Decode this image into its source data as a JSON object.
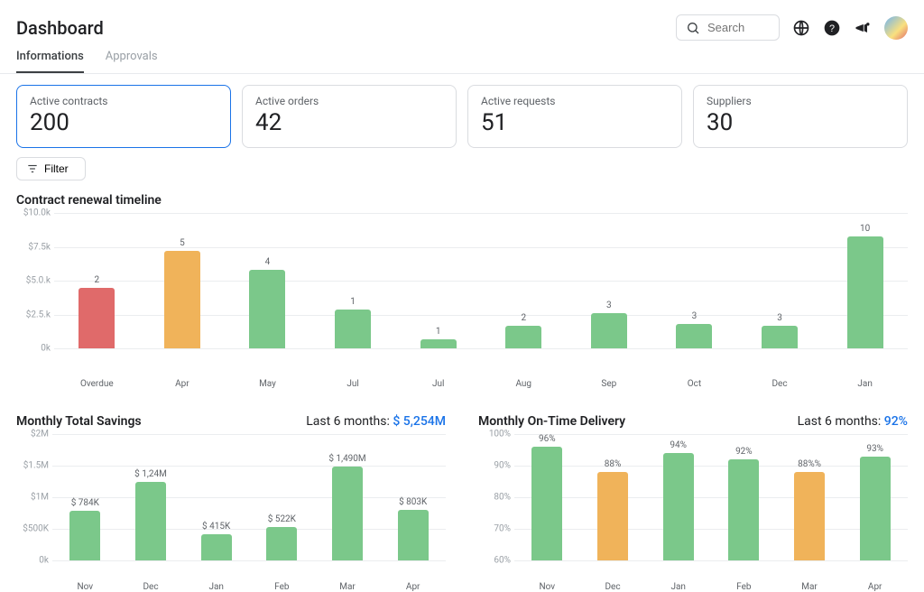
{
  "header": {
    "title": "Dashboard",
    "search_placeholder": "Search"
  },
  "tabs": {
    "informations": "Informations",
    "approvals": "Approvals"
  },
  "kpis": [
    {
      "label": "Active contracts",
      "value": "200",
      "active": true
    },
    {
      "label": "Active orders",
      "value": "42",
      "active": false
    },
    {
      "label": "Active requests",
      "value": "51",
      "active": false
    },
    {
      "label": "Suppliers",
      "value": "30",
      "active": false
    }
  ],
  "filter_label": "Filter",
  "renewal_title": "Contract renewal timeline",
  "chart_data": [
    {
      "type": "bar",
      "title": "Contract renewal timeline",
      "xlabel": "",
      "ylabel": "",
      "ylim": [
        0,
        10000
      ],
      "y_ticks": [
        "0k",
        "$2.5.k",
        "$5.0.k",
        "$7.5k",
        "$10.0k"
      ],
      "categories": [
        "Overdue",
        "Apr",
        "May",
        "Jul",
        "Jul",
        "Aug",
        "Sep",
        "Oct",
        "Dec",
        "Jan"
      ],
      "bar_value_labels": [
        "2",
        "5",
        "4",
        "1",
        "1",
        "2",
        "3",
        "3",
        "3",
        "10"
      ],
      "values": [
        4500,
        7200,
        5800,
        2900,
        700,
        1700,
        2600,
        1800,
        1700,
        8300
      ],
      "colors": [
        "#e06a6a",
        "#f0b35a",
        "#7bc88a",
        "#7bc88a",
        "#7bc88a",
        "#7bc88a",
        "#7bc88a",
        "#7bc88a",
        "#7bc88a",
        "#7bc88a"
      ]
    },
    {
      "type": "bar",
      "title": "Monthly Total Savings",
      "subtitle_label": "Last 6 months:",
      "subtitle_value": "$ 5,254M",
      "xlabel": "",
      "ylabel": "",
      "ylim": [
        0,
        2000000
      ],
      "y_ticks": [
        "0k",
        "$500K",
        "$1M",
        "$1.5M",
        "$2M"
      ],
      "categories": [
        "Nov",
        "Dec",
        "Jan",
        "Feb",
        "Mar",
        "Apr"
      ],
      "bar_value_labels": [
        "$ 784K",
        "$ 1,24M",
        "$ 415K",
        "$ 522K",
        "$ 1,490M",
        "$ 803K"
      ],
      "values": [
        784000,
        1240000,
        415000,
        522000,
        1490000,
        803000
      ],
      "colors": [
        "#7bc88a",
        "#7bc88a",
        "#7bc88a",
        "#7bc88a",
        "#7bc88a",
        "#7bc88a"
      ]
    },
    {
      "type": "bar",
      "title": "Monthly On-Time Delivery",
      "subtitle_label": "Last 6 months:",
      "subtitle_value": "92%",
      "xlabel": "",
      "ylabel": "",
      "ylim": [
        60,
        100
      ],
      "y_ticks": [
        "60%",
        "70%",
        "80%",
        "90%",
        "100%"
      ],
      "categories": [
        "Nov",
        "Dec",
        "Jan",
        "Feb",
        "Mar",
        "Apr"
      ],
      "bar_value_labels": [
        "96%",
        "88%",
        "94%",
        "92%",
        "88%%",
        "93%"
      ],
      "values": [
        96,
        88,
        94,
        92,
        88,
        93
      ],
      "colors": [
        "#7bc88a",
        "#f0b35a",
        "#7bc88a",
        "#7bc88a",
        "#f0b35a",
        "#7bc88a"
      ]
    }
  ]
}
